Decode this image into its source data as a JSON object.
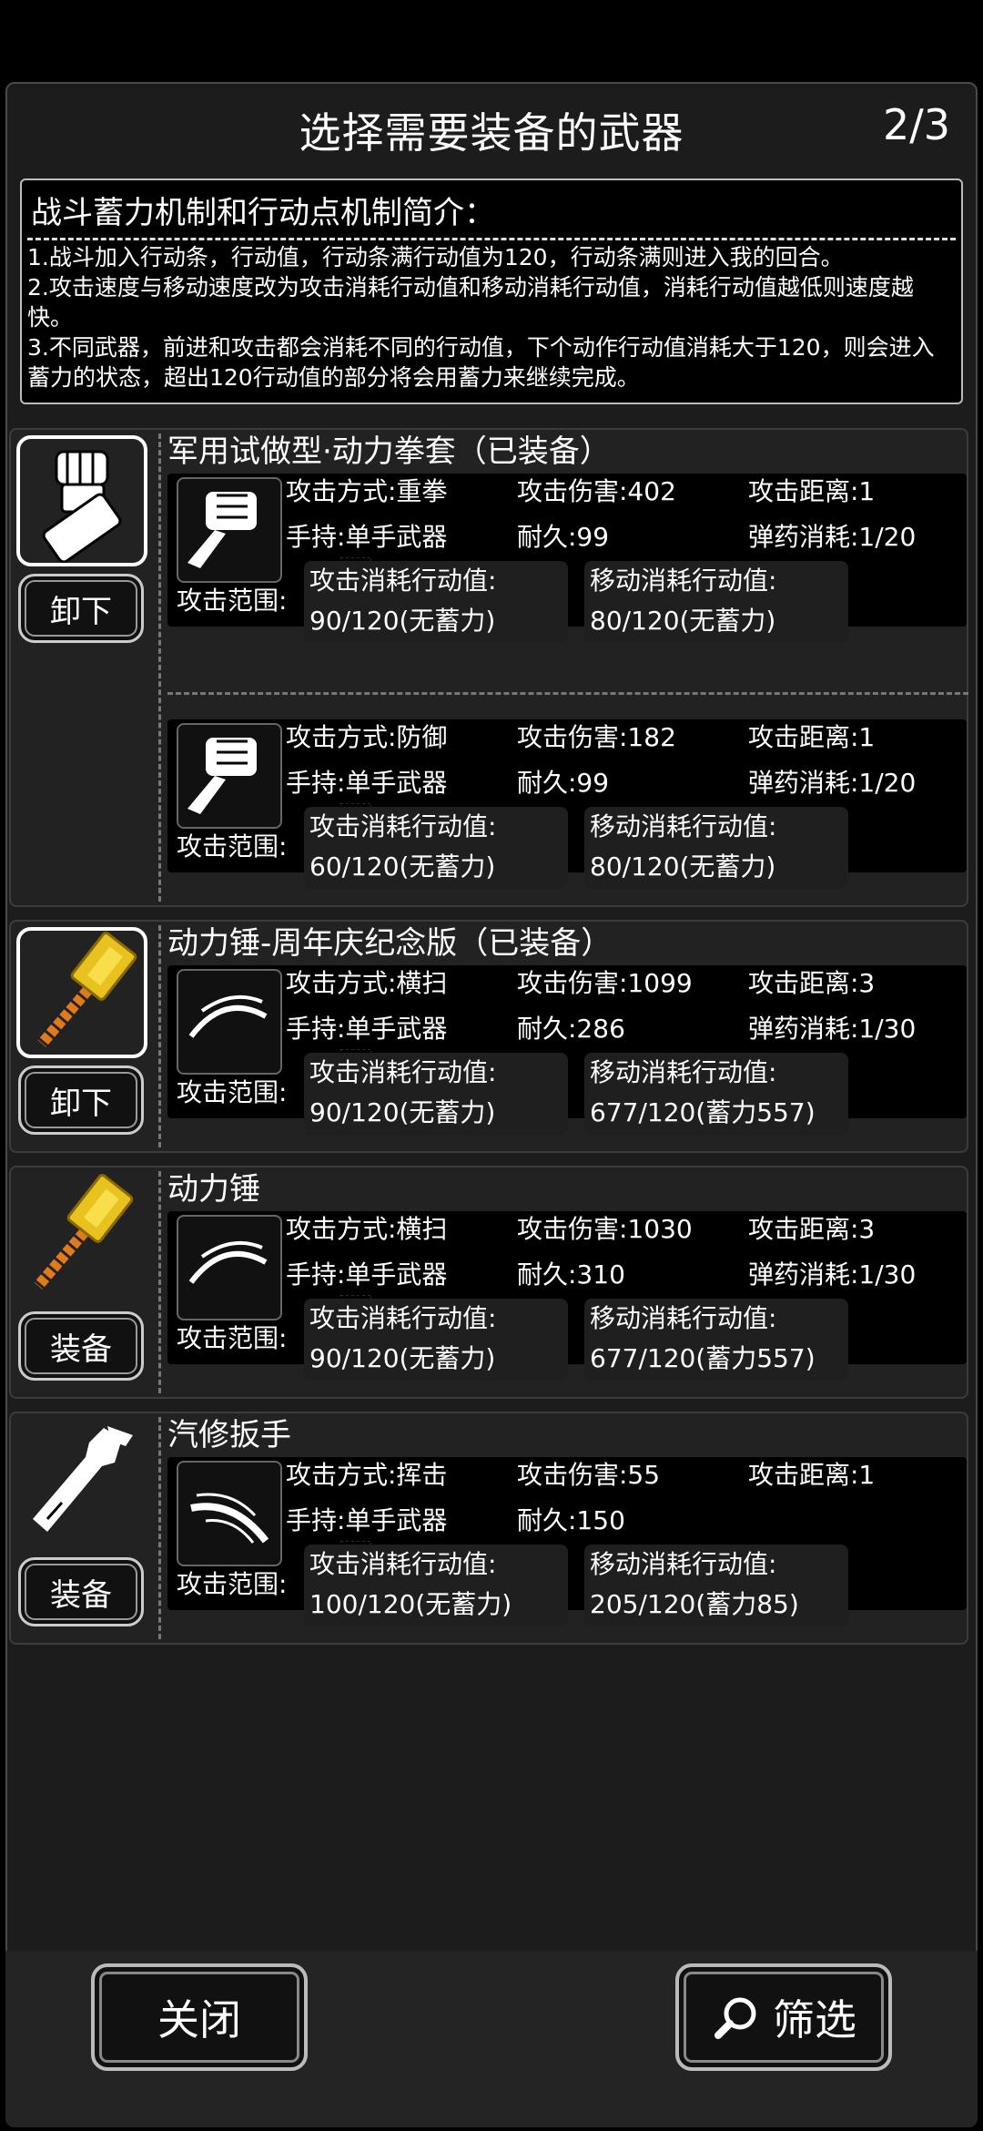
{
  "header": {
    "title": "选择需要装备的武器",
    "page_indicator": "2/3"
  },
  "intro": {
    "title": "战斗蓄力机制和行动点机制简介：",
    "lines": [
      "1.战斗加入行动条，行动值，行动条满行动值为120，行动条满则进入我的回合。",
      "2.攻击速度与移动速度改为攻击消耗行动值和移动消耗行动值，消耗行动值越低则速度越快。",
      "3.不同武器，前进和攻击都会消耗不同的行动值，下个动作行动值消耗大于120，则会进入蓄力的状态，超出120行动值的部分将会用蓄力来继续完成。"
    ]
  },
  "labels": {
    "range": "攻击范围:",
    "attack_cost": "攻击消耗行动值:",
    "move_cost": "移动消耗行动值:"
  },
  "weapons": [
    {
      "name": "军用试做型·动力拳套（已装备）",
      "icon": "power-gauntlet-icon",
      "equipped": true,
      "button": "卸下",
      "modes": [
        {
          "icon": "fist-icon",
          "method": "攻击方式:重拳",
          "damage": "攻击伤害:402",
          "distance": "攻击距离:1",
          "hold": "手持:单手武器",
          "durability": "耐久:99",
          "ammo": "弹药消耗:1/20",
          "attack_cost": "90/120(无蓄力)",
          "move_cost": "80/120(无蓄力)"
        },
        {
          "icon": "fist-icon",
          "method": "攻击方式:防御",
          "damage": "攻击伤害:182",
          "distance": "攻击距离:1",
          "hold": "手持:单手武器",
          "durability": "耐久:99",
          "ammo": "弹药消耗:1/20",
          "attack_cost": "60/120(无蓄力)",
          "move_cost": "80/120(无蓄力)"
        }
      ]
    },
    {
      "name": "动力锤-周年庆纪念版（已装备）",
      "icon": "power-hammer-icon",
      "equipped": true,
      "button": "卸下",
      "modes": [
        {
          "icon": "sweep-icon",
          "method": "攻击方式:横扫",
          "damage": "攻击伤害:1099",
          "distance": "攻击距离:3",
          "hold": "手持:单手武器",
          "durability": "耐久:286",
          "ammo": "弹药消耗:1/30",
          "attack_cost": "90/120(无蓄力)",
          "move_cost": "677/120(蓄力557)"
        }
      ]
    },
    {
      "name": "动力锤",
      "icon": "power-hammer-icon",
      "equipped": false,
      "button": "装备",
      "modes": [
        {
          "icon": "sweep-icon",
          "method": "攻击方式:横扫",
          "damage": "攻击伤害:1030",
          "distance": "攻击距离:3",
          "hold": "手持:单手武器",
          "durability": "耐久:310",
          "ammo": "弹药消耗:1/30",
          "attack_cost": "90/120(无蓄力)",
          "move_cost": "677/120(蓄力557)"
        }
      ]
    },
    {
      "name": "汽修扳手",
      "icon": "wrench-icon",
      "equipped": false,
      "button": "装备",
      "modes": [
        {
          "icon": "swing-icon",
          "method": "攻击方式:挥击",
          "damage": "攻击伤害:55",
          "distance": "攻击距离:1",
          "hold": "手持:单手武器",
          "durability": "耐久:150",
          "ammo": "",
          "attack_cost": "100/120(无蓄力)",
          "move_cost": "205/120(蓄力85)"
        }
      ]
    }
  ],
  "footer": {
    "close_label": "关闭",
    "filter_label": "筛选",
    "filter_icon": "search-icon"
  }
}
